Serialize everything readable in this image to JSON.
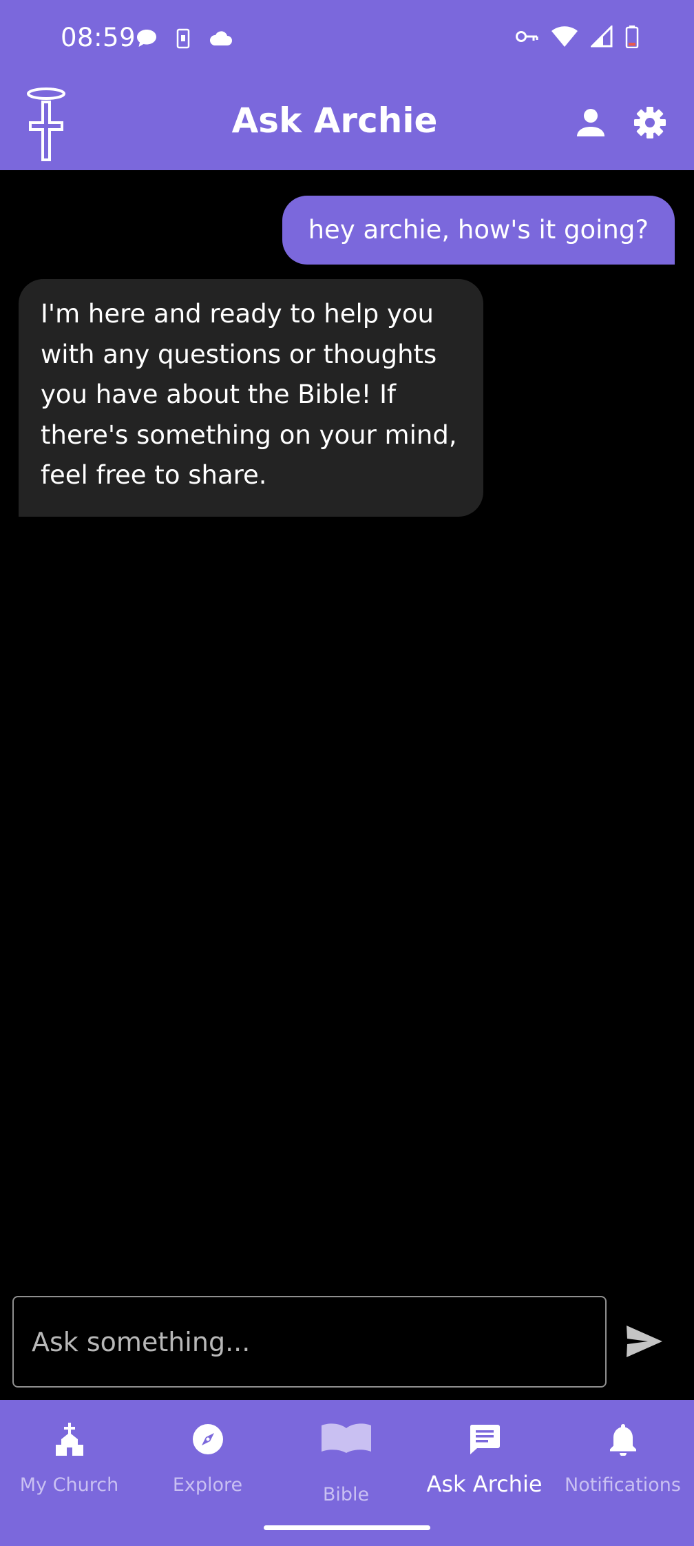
{
  "status_bar": {
    "time": "08:59",
    "left_icons": [
      "chat-bubble-icon",
      "sim-card-icon",
      "cloud-icon"
    ],
    "right_icons": [
      "vpn-key-icon",
      "wifi-icon",
      "cellular-signal-icon",
      "battery-low-icon"
    ]
  },
  "header": {
    "title": "Ask Archie",
    "logo_icon": "halo-cross-icon",
    "actions": [
      "profile-icon",
      "settings-gear-icon"
    ]
  },
  "chat": {
    "messages": [
      {
        "role": "user",
        "text": "hey archie, how's it going?"
      },
      {
        "role": "assistant",
        "text": "I'm here and ready to help you with any questions or thoughts you have about the Bible! If there's something on your mind, feel free to share."
      }
    ]
  },
  "composer": {
    "placeholder": "Ask something...",
    "value": "",
    "send_icon": "send-icon"
  },
  "bottom_nav": {
    "items": [
      {
        "label": "My Church",
        "icon": "church-icon",
        "active": false
      },
      {
        "label": "Explore",
        "icon": "compass-icon",
        "active": false
      },
      {
        "label": "Bible",
        "icon": "open-book-icon",
        "active": false
      },
      {
        "label": "Ask Archie",
        "icon": "chat-message-icon",
        "active": true
      },
      {
        "label": "Notifications",
        "icon": "bell-icon",
        "active": false
      }
    ]
  },
  "colors": {
    "accent": "#7b68dc",
    "background": "#000000",
    "assistant_bubble": "#232323",
    "inactive_nav": "#c9c0f2",
    "battery_low": "#e85a4f"
  }
}
